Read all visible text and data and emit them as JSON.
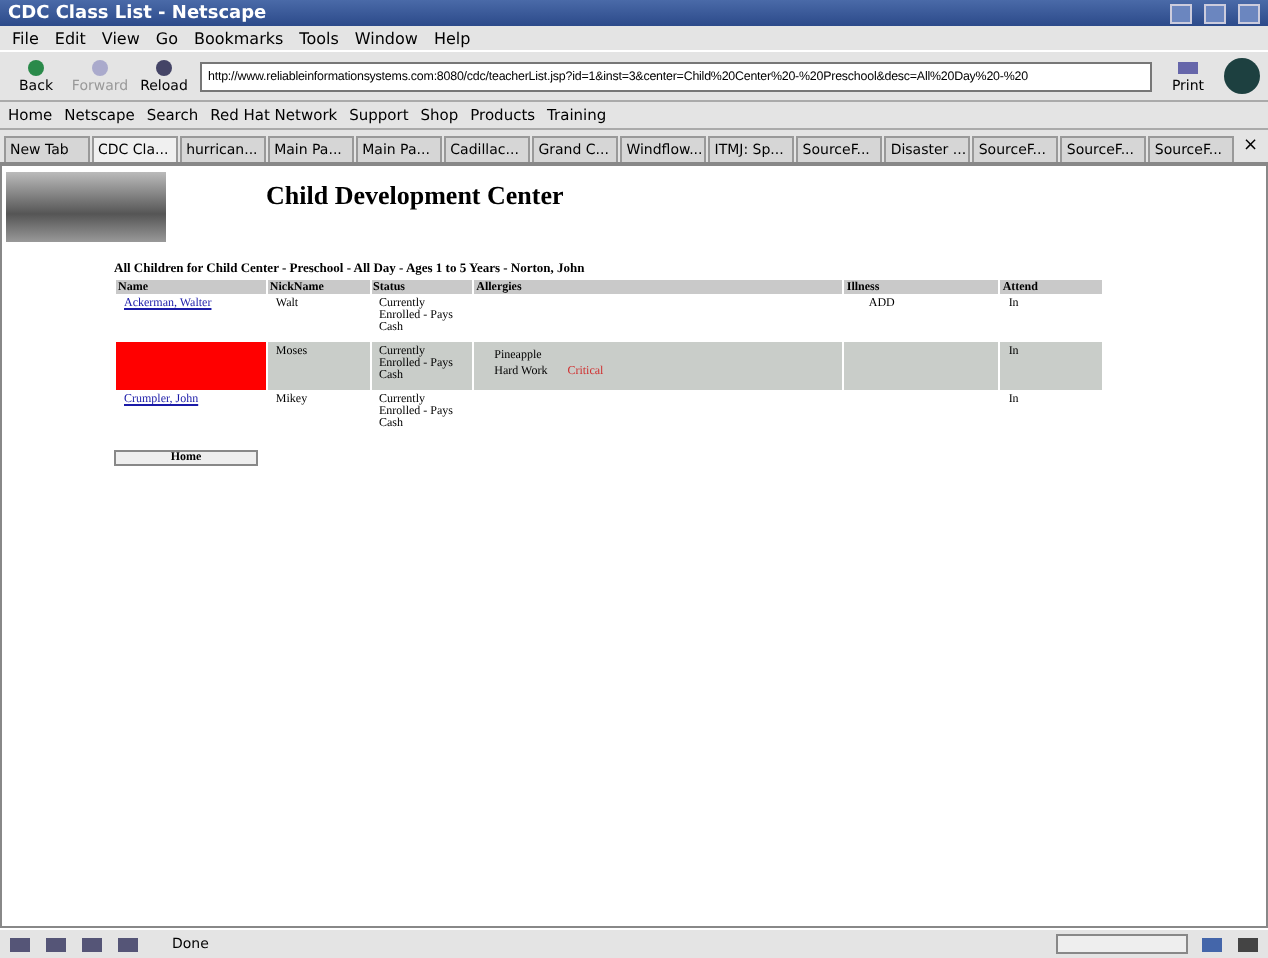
{
  "window": {
    "title": "CDC Class List - Netscape"
  },
  "menu": [
    "File",
    "Edit",
    "View",
    "Go",
    "Bookmarks",
    "Tools",
    "Window",
    "Help"
  ],
  "nav_buttons": [
    {
      "label": "Back",
      "disabled": false
    },
    {
      "label": "Forward",
      "disabled": true
    },
    {
      "label": "Reload",
      "disabled": false
    }
  ],
  "url": "http://www.reliableinformationsystems.com:8080/cdc/teacherList.jsp?id=1&inst=3&center=Child%20Center%20-%20Preschool&desc=All%20Day%20-%20",
  "print_label": "Print",
  "close_tab": "×",
  "progress": {
    "level": 0
  },
  "bookmarks": [
    "Home",
    "Netscape",
    "Search",
    "Red Hat Network",
    "Support",
    "Shop",
    "Products",
    "Training"
  ],
  "tabs": [
    {
      "label": "New Tab",
      "selected": false
    },
    {
      "label": "CDC Cla...",
      "selected": true
    },
    {
      "label": "hurrican...",
      "selected": false
    },
    {
      "label": "Main Pa...",
      "selected": false
    },
    {
      "label": "Main Pa...",
      "selected": false
    },
    {
      "label": "Cadillac...",
      "selected": false
    },
    {
      "label": "Grand C...",
      "selected": false
    },
    {
      "label": "Windflow...",
      "selected": false
    },
    {
      "label": "ITMJ: Sp...",
      "selected": false
    },
    {
      "label": "SourceF...",
      "selected": false
    },
    {
      "label": "Disaster ...",
      "selected": false
    },
    {
      "label": "SourceF...",
      "selected": false
    },
    {
      "label": "SourceF...",
      "selected": false
    },
    {
      "label": "SourceF...",
      "selected": false
    }
  ],
  "page": {
    "heading": "Child Development Center",
    "subtitle": "All Children for Child Center - Preschool - All Day - Ages 1 to 5 Years - Norton, John",
    "columns": [
      "Name",
      "NickName",
      "Status",
      "Allergies",
      "Illness",
      "Attend"
    ],
    "rows": [
      {
        "name": "Ackerman, Walter",
        "alert": false,
        "shaded": false,
        "nickname": "Walt",
        "status": "Currently Enrolled - Pays Cash",
        "allergies": [],
        "illness": "ADD",
        "attend": "In"
      },
      {
        "alert": true,
        "shaded": true,
        "nickname": "Moses",
        "status": "Currently Enrolled - Pays Cash",
        "allergies": [
          {
            "name": "Pineapple"
          },
          {
            "name": "Hard Work",
            "severity": "Critical"
          }
        ],
        "attend": "In"
      },
      {
        "name": "Crumpler, John",
        "alert": false,
        "shaded": false,
        "nickname": "Mikey",
        "status": "Currently Enrolled - Pays Cash",
        "allergies": [],
        "attend": "In"
      }
    ],
    "home_button": "Home"
  },
  "status_bar": {
    "text": "Done"
  }
}
